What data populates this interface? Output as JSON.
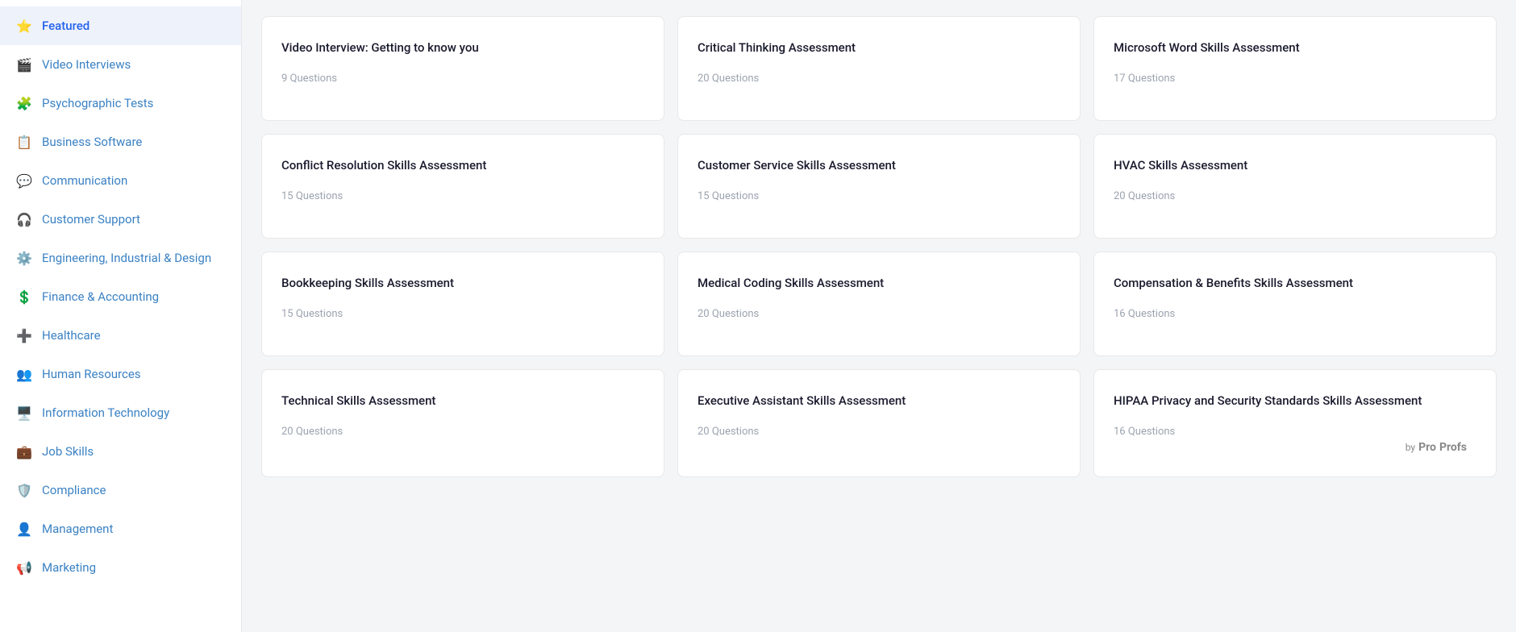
{
  "sidebar": {
    "items": [
      {
        "id": "featured",
        "label": "Featured",
        "icon": "⭐",
        "active": true
      },
      {
        "id": "video-interviews",
        "label": "Video Interviews",
        "icon": "🎬"
      },
      {
        "id": "psychographic-tests",
        "label": "Psychographic Tests",
        "icon": "🧩"
      },
      {
        "id": "business-software",
        "label": "Business Software",
        "icon": "📋"
      },
      {
        "id": "communication",
        "label": "Communication",
        "icon": "💬"
      },
      {
        "id": "customer-support",
        "label": "Customer Support",
        "icon": "🎧"
      },
      {
        "id": "engineering-industrial-design",
        "label": "Engineering, Industrial & Design",
        "icon": "⚙️"
      },
      {
        "id": "finance-accounting",
        "label": "Finance & Accounting",
        "icon": "💲"
      },
      {
        "id": "healthcare",
        "label": "Healthcare",
        "icon": "➕"
      },
      {
        "id": "human-resources",
        "label": "Human Resources",
        "icon": "👥"
      },
      {
        "id": "information-technology",
        "label": "Information Technology",
        "icon": "🖥️"
      },
      {
        "id": "job-skills",
        "label": "Job Skills",
        "icon": "💼"
      },
      {
        "id": "compliance",
        "label": "Compliance",
        "icon": "🛡️"
      },
      {
        "id": "management",
        "label": "Management",
        "icon": "👤"
      },
      {
        "id": "marketing",
        "label": "Marketing",
        "icon": "📢"
      }
    ]
  },
  "cards": [
    {
      "id": "card-1",
      "title": "Video Interview: Getting to know you",
      "questions": "9 Questions"
    },
    {
      "id": "card-2",
      "title": "Critical Thinking Assessment",
      "questions": "20 Questions"
    },
    {
      "id": "card-3",
      "title": "Microsoft Word Skills Assessment",
      "questions": "17 Questions"
    },
    {
      "id": "card-4",
      "title": "Conflict Resolution Skills Assessment",
      "questions": "15 Questions"
    },
    {
      "id": "card-5",
      "title": "Customer Service Skills Assessment",
      "questions": "15 Questions"
    },
    {
      "id": "card-6",
      "title": "HVAC Skills Assessment",
      "questions": "20 Questions"
    },
    {
      "id": "card-7",
      "title": "Bookkeeping Skills Assessment",
      "questions": "15 Questions"
    },
    {
      "id": "card-8",
      "title": "Medical Coding Skills Assessment",
      "questions": "20 Questions"
    },
    {
      "id": "card-9",
      "title": "Compensation & Benefits Skills Assessment",
      "questions": "16 Questions"
    },
    {
      "id": "card-10",
      "title": "Technical Skills Assessment",
      "questions": "20 Questions"
    },
    {
      "id": "card-11",
      "title": "Executive Assistant Skills Assessment",
      "questions": "20 Questions"
    },
    {
      "id": "card-12",
      "title": "HIPAA Privacy and Security Standards Skills Assessment",
      "questions": "16 Questions"
    }
  ],
  "brand": {
    "by": "by",
    "pro": "Pro",
    "profs": "Profs"
  }
}
